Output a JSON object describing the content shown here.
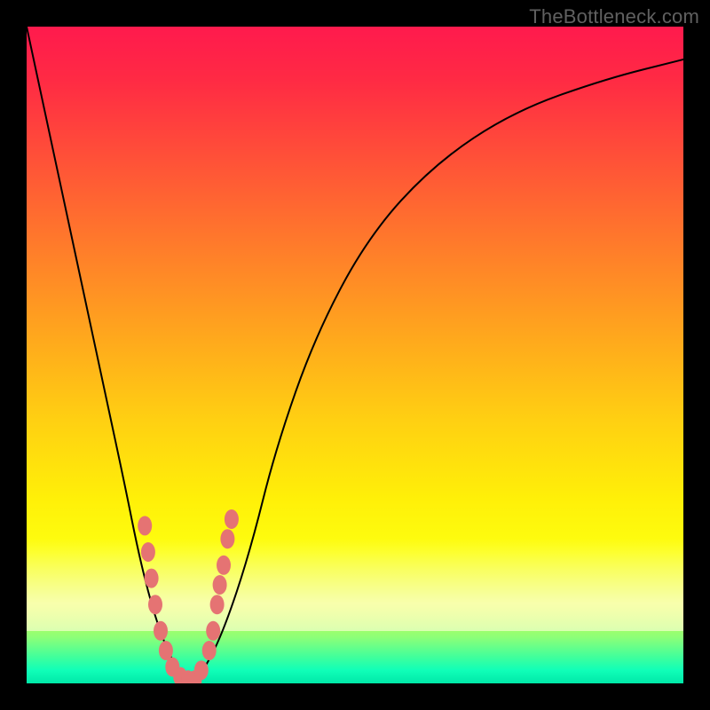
{
  "watermark": "TheBottleneck.com",
  "chart_data": {
    "type": "line",
    "title": "",
    "xlabel": "",
    "ylabel": "",
    "xlim": [
      0,
      100
    ],
    "ylim": [
      0,
      100
    ],
    "background_gradient": [
      "#ff1a4d",
      "#ff6a30",
      "#ffd012",
      "#fdff10",
      "#40ff9c",
      "#00e8a8"
    ],
    "series": [
      {
        "name": "bottleneck-curve",
        "x": [
          0,
          3,
          6,
          9,
          12,
          15,
          17,
          19,
          21,
          23,
          25,
          27,
          30,
          34,
          38,
          44,
          52,
          62,
          74,
          88,
          100
        ],
        "values": [
          100,
          86,
          72,
          58,
          44,
          30,
          20,
          12,
          6,
          2,
          0,
          2,
          8,
          20,
          36,
          53,
          68,
          79,
          87,
          92,
          95
        ]
      }
    ],
    "markers": {
      "name": "data-points",
      "color": "#e57373",
      "points": [
        {
          "x": 18.0,
          "y": 24
        },
        {
          "x": 18.5,
          "y": 20
        },
        {
          "x": 19.0,
          "y": 16
        },
        {
          "x": 19.6,
          "y": 12
        },
        {
          "x": 20.4,
          "y": 8
        },
        {
          "x": 21.2,
          "y": 5
        },
        {
          "x": 22.2,
          "y": 2.5
        },
        {
          "x": 23.4,
          "y": 1
        },
        {
          "x": 24.6,
          "y": 0.5
        },
        {
          "x": 25.6,
          "y": 0.5
        },
        {
          "x": 26.6,
          "y": 2
        },
        {
          "x": 27.8,
          "y": 5
        },
        {
          "x": 28.4,
          "y": 8
        },
        {
          "x": 29.0,
          "y": 12
        },
        {
          "x": 29.4,
          "y": 15
        },
        {
          "x": 30.0,
          "y": 18
        },
        {
          "x": 30.6,
          "y": 22
        },
        {
          "x": 31.2,
          "y": 25
        }
      ]
    }
  }
}
